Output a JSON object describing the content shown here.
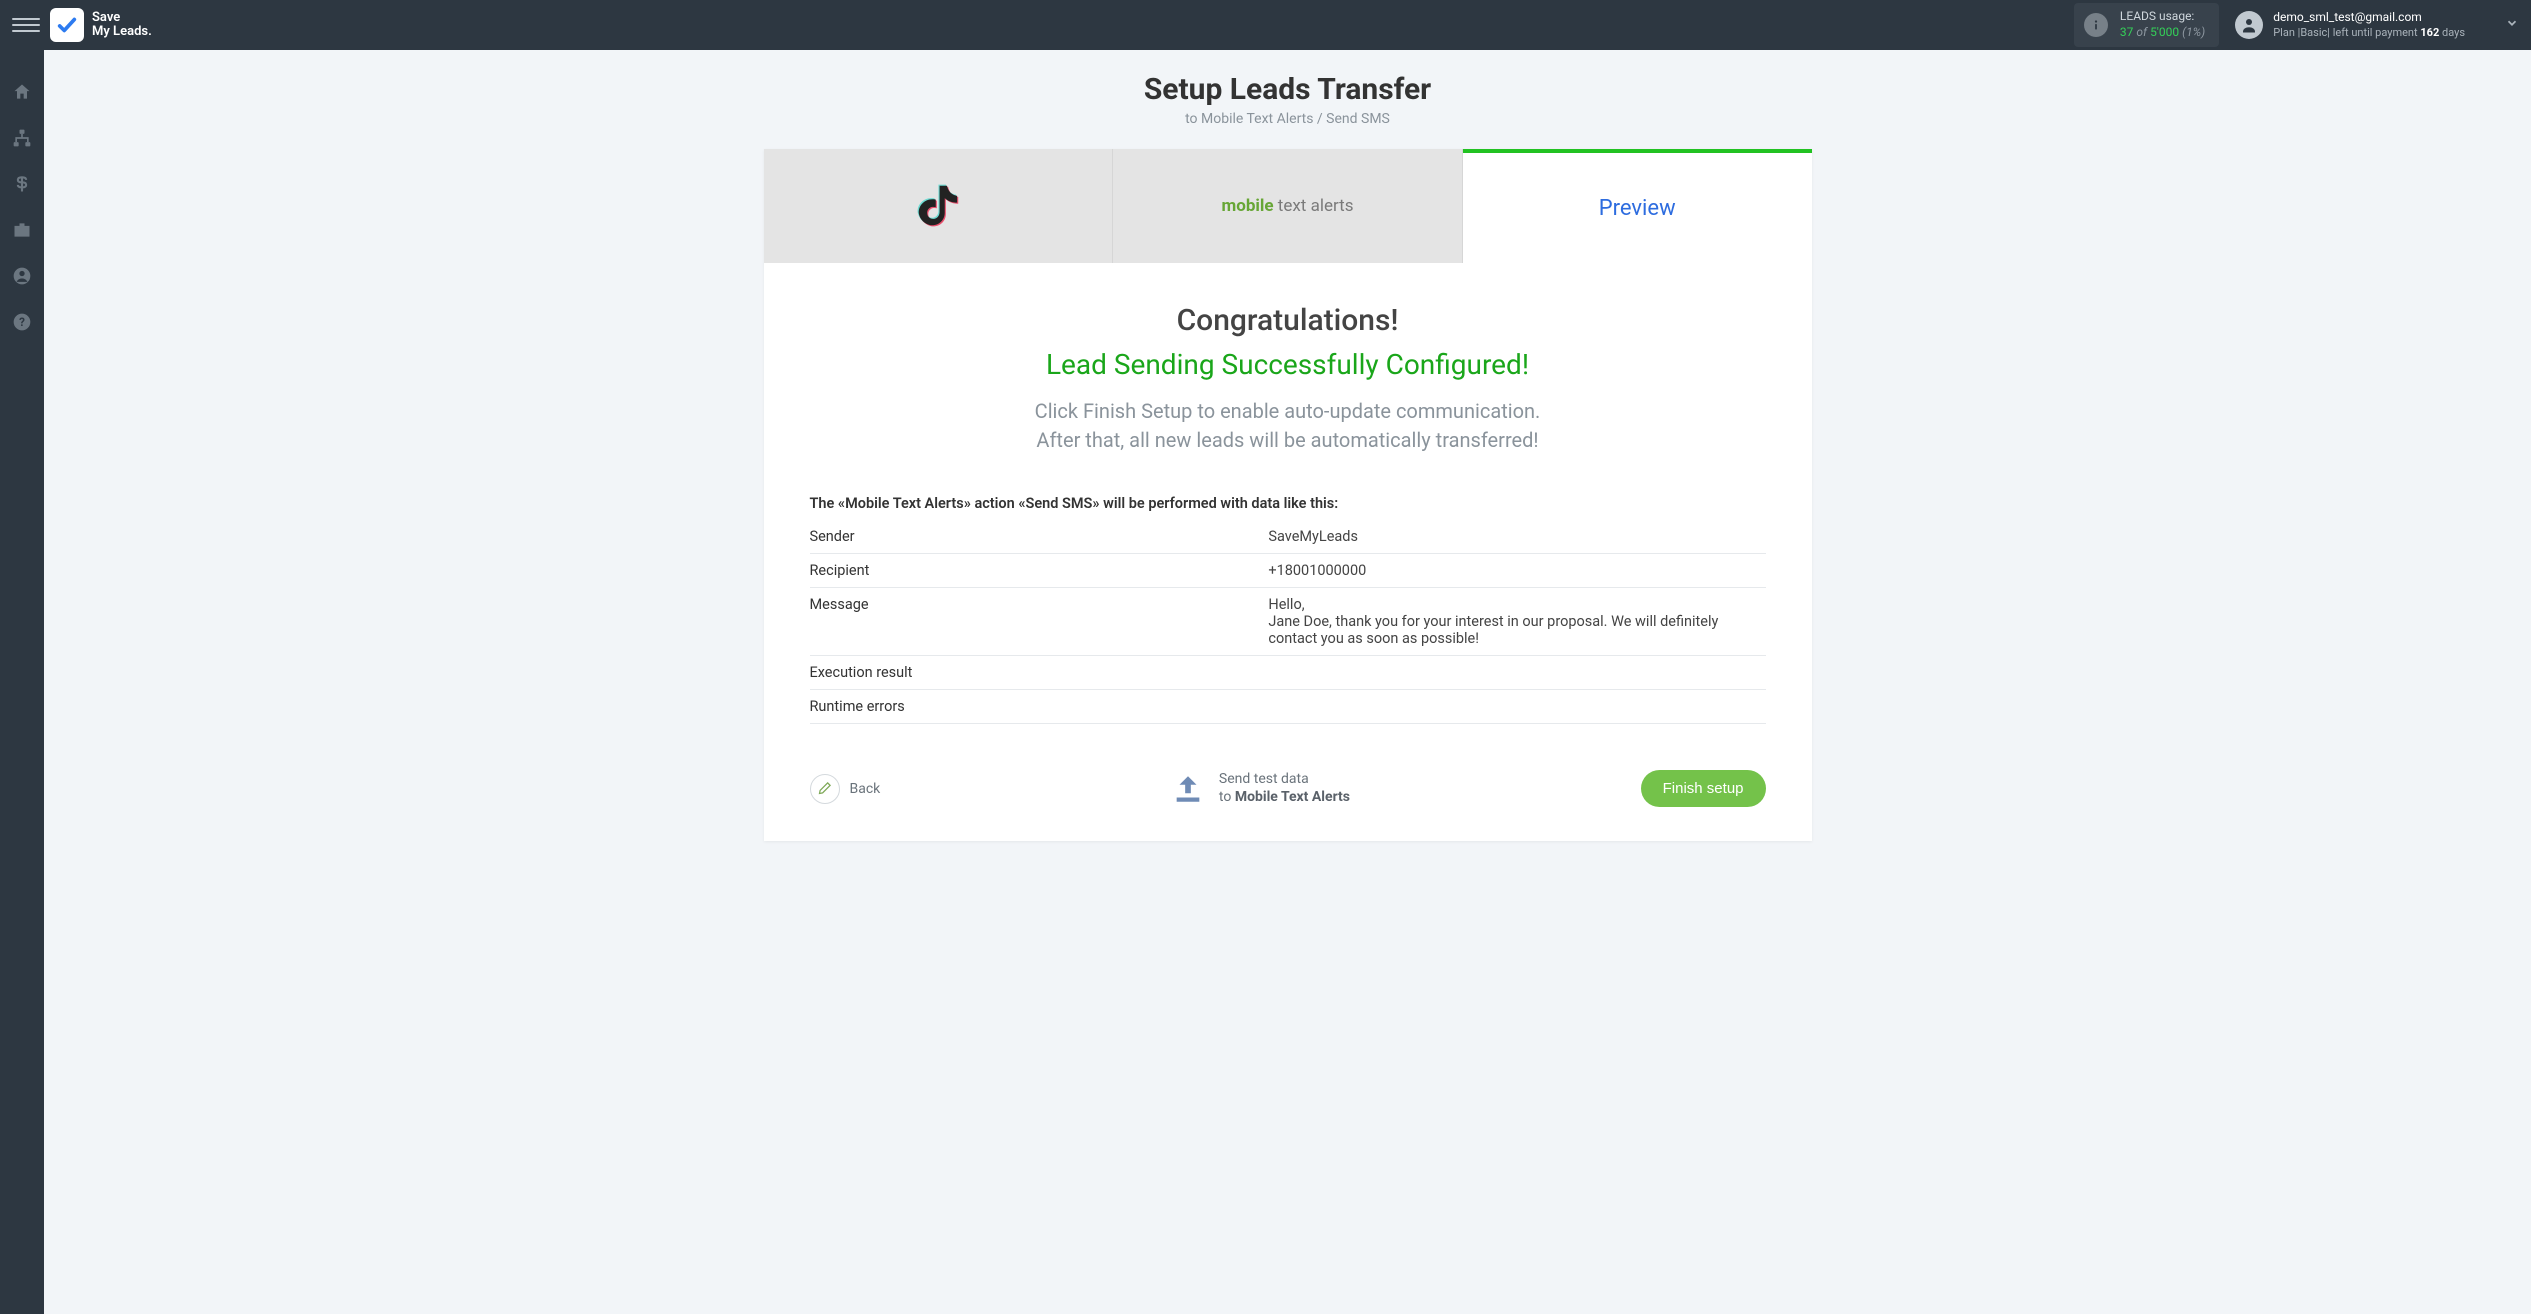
{
  "brand": {
    "line1": "Save",
    "line2": "My Leads."
  },
  "usage": {
    "label": "LEADS usage:",
    "used": "37",
    "of": "of",
    "total": "5'000",
    "pct": "(1%)"
  },
  "account": {
    "email": "demo_sml_test@gmail.com",
    "plan_prefix": "Plan |",
    "plan_name": "Basic",
    "plan_mid": "| left until payment ",
    "days": "162",
    "days_suffix": " days"
  },
  "page": {
    "title": "Setup Leads Transfer",
    "subtitle": "to Mobile Text Alerts / Send SMS"
  },
  "tabs": {
    "source_name": "TikTok",
    "mta_bold": "mobile",
    "mta_rest": " text alerts",
    "preview": "Preview"
  },
  "congrats": {
    "title": "Congratulations!",
    "success": "Lead Sending Successfully Configured!",
    "desc1": "Click Finish Setup to enable auto-update communication.",
    "desc2": "After that, all new leads will be automatically transferred!"
  },
  "action_intro": "The «Mobile Text Alerts» action «Send SMS» will be performed with data like this:",
  "rows": {
    "sender_label": "Sender",
    "sender_value": "SaveMyLeads",
    "recipient_label": "Recipient",
    "recipient_value": "+18001000000",
    "message_label": "Message",
    "message_l1": "Hello,",
    "message_l2": "Jane Doe, thank you for your interest in our proposal. We will definitely contact you as soon as possible!",
    "exec_label": "Execution result",
    "exec_value": "",
    "err_label": "Runtime errors",
    "err_value": ""
  },
  "footer": {
    "back": "Back",
    "send_l1": "Send test data",
    "send_prefix": "to ",
    "send_bold": "Mobile Text Alerts",
    "finish": "Finish setup"
  }
}
